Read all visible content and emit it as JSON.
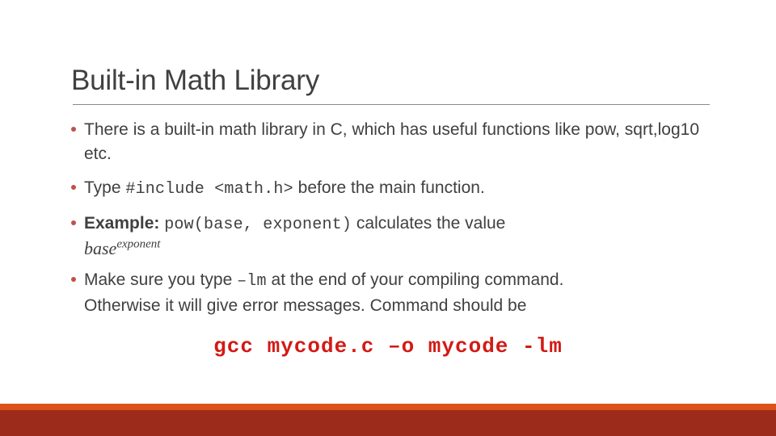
{
  "slide": {
    "title": "Built-in Math Library",
    "background_color": "#ffffff",
    "title_color": "#404040",
    "rule_color": "#898989",
    "bullet_color": "#C0504D"
  },
  "bullets": [
    {
      "id": "bullet-math-library",
      "seg1": "There is a built-in math library in C, which has useful functions like pow, sqrt,log10 etc."
    },
    {
      "id": "bullet-include",
      "seg1": "Type ",
      "code": "#include <math.h>",
      "seg2": "  before the main function."
    },
    {
      "id": "bullet-example",
      "seg1": "Example: ",
      "code": "pow(base, exponent)",
      "seg2": "  calculates the value",
      "math_base": "base",
      "math_exponent": "exponent"
    },
    {
      "id": "bullet-lm-flag",
      "seg1": "Make sure you type ",
      "code": "–lm",
      "seg2": "  at the end of your compiling command.",
      "continuation": "Otherwise it will give error messages.   Command should be"
    }
  ],
  "command": {
    "text": "gcc mycode.c –o mycode -lm",
    "color": "#D31A15"
  },
  "footer": {
    "orange_bar_color": "#DC5218",
    "dark_red_bar_color": "#9C2B1B"
  }
}
